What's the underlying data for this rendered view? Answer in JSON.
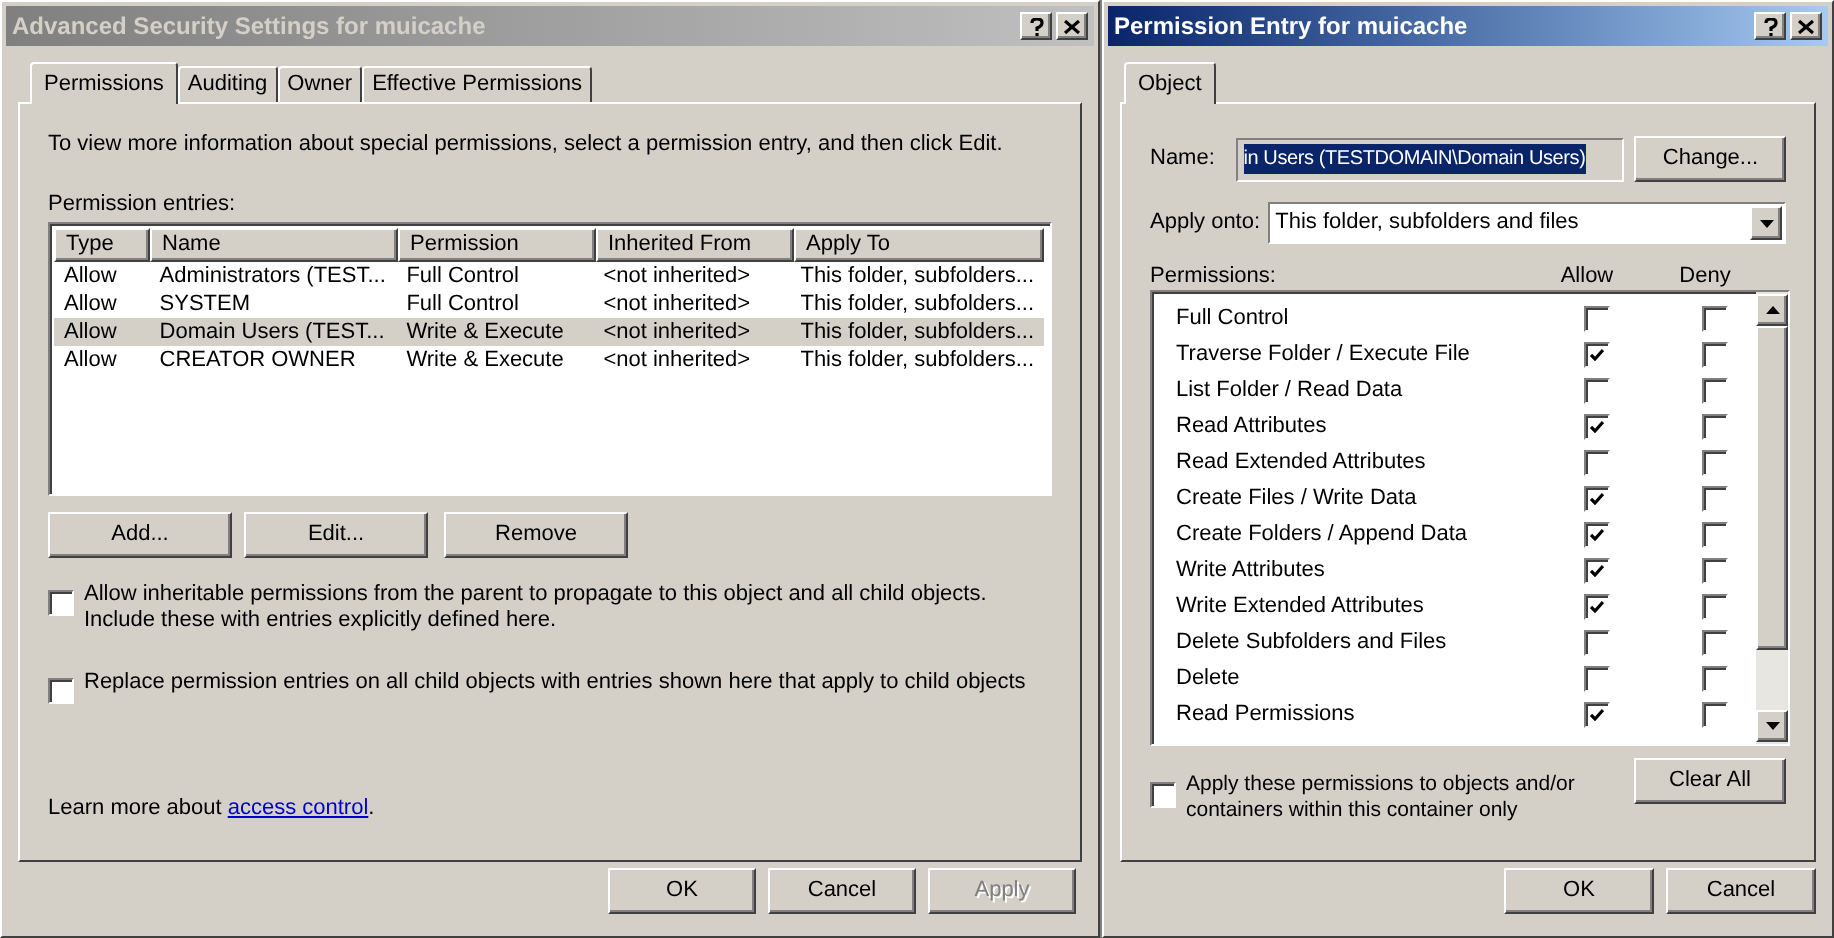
{
  "security_window": {
    "title": "Advanced Security Settings for muicache",
    "active": false,
    "tabs": [
      {
        "label": "Permissions",
        "selected": true
      },
      {
        "label": "Auditing",
        "selected": false
      },
      {
        "label": "Owner",
        "selected": false
      },
      {
        "label": "Effective Permissions",
        "selected": false
      }
    ],
    "intro": "To view more information about special permissions, select a permission entry, and then click Edit.",
    "entries_label": "Permission entries:",
    "table": {
      "columns": [
        "Type",
        "Name",
        "Permission",
        "Inherited From",
        "Apply To"
      ],
      "rows": [
        {
          "cells": [
            "Allow",
            "Administrators (TEST...",
            "Full Control",
            "<not inherited>",
            "This folder, subfolders..."
          ],
          "selected": false
        },
        {
          "cells": [
            "Allow",
            "SYSTEM",
            "Full Control",
            "<not inherited>",
            "This folder, subfolders..."
          ],
          "selected": false
        },
        {
          "cells": [
            "Allow",
            "Domain Users (TEST...",
            "Write & Execute",
            "<not inherited>",
            "This folder, subfolders..."
          ],
          "selected": true
        },
        {
          "cells": [
            "Allow",
            "CREATOR OWNER",
            "Write & Execute",
            "<not inherited>",
            "This folder, subfolders..."
          ],
          "selected": false
        }
      ]
    },
    "entry_buttons": [
      "Add...",
      "Edit...",
      "Remove"
    ],
    "options": [
      {
        "label": "Allow inheritable permissions from the parent to propagate to this object and all child objects. Include these with entries explicitly defined here.",
        "checked": false
      },
      {
        "label": "Replace permission entries on all child objects with entries shown here that apply to child objects",
        "checked": false
      }
    ],
    "learn_more": {
      "text": "Learn more about",
      "link": "access control",
      "after": "."
    },
    "buttons": [
      {
        "label": "OK",
        "disabled": false
      },
      {
        "label": "Cancel",
        "disabled": false
      },
      {
        "label": "Apply",
        "disabled": true
      }
    ]
  },
  "entry_window": {
    "title": "Permission Entry for muicache",
    "active": true,
    "tabs": [
      {
        "label": "Object",
        "selected": true
      }
    ],
    "name_label": "Name:",
    "name_value": "in Users (TESTDOMAIN\\Domain Users)",
    "change_button": "Change...",
    "apply_label": "Apply onto:",
    "apply_value": "This folder, subfolders and files",
    "permissions_label": "Permissions:",
    "allow_header": "Allow",
    "deny_header": "Deny",
    "permissions": [
      {
        "name": "Full Control",
        "allow": false,
        "deny": false
      },
      {
        "name": "Traverse Folder / Execute File",
        "allow": true,
        "deny": false
      },
      {
        "name": "List Folder / Read Data",
        "allow": false,
        "deny": false
      },
      {
        "name": "Read Attributes",
        "allow": true,
        "deny": false
      },
      {
        "name": "Read Extended Attributes",
        "allow": false,
        "deny": false
      },
      {
        "name": "Create Files / Write Data",
        "allow": true,
        "deny": false
      },
      {
        "name": "Create Folders / Append Data",
        "allow": true,
        "deny": false
      },
      {
        "name": "Write Attributes",
        "allow": true,
        "deny": false
      },
      {
        "name": "Write Extended Attributes",
        "allow": true,
        "deny": false
      },
      {
        "name": "Delete Subfolders and Files",
        "allow": false,
        "deny": false
      },
      {
        "name": "Delete",
        "allow": false,
        "deny": false
      },
      {
        "name": "Read Permissions",
        "allow": true,
        "deny": false
      }
    ],
    "apply_only": {
      "label": "Apply these permissions to objects and/or containers within this container only",
      "checked": false
    },
    "clear_button": "Clear All",
    "buttons": [
      {
        "label": "OK",
        "disabled": false
      },
      {
        "label": "Cancel",
        "disabled": false
      }
    ]
  }
}
